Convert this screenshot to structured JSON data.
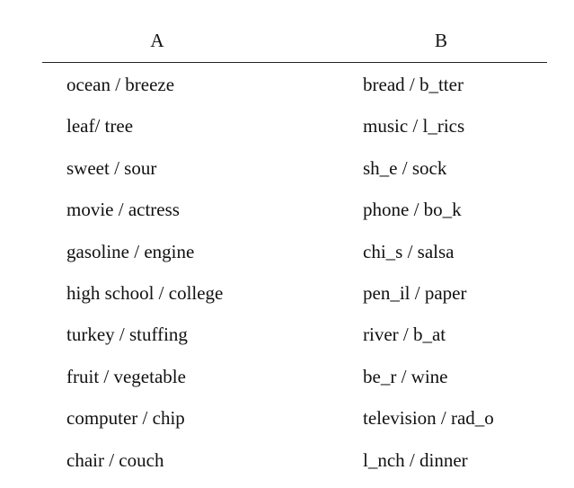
{
  "table": {
    "headers": [
      "A",
      "B"
    ],
    "rows": [
      {
        "a": "ocean / breeze",
        "b": "bread / b_tter"
      },
      {
        "a": "leaf/ tree",
        "b": "music / l_rics"
      },
      {
        "a": "sweet / sour",
        "b": "sh_e / sock"
      },
      {
        "a": "movie / actress",
        "b": "phone / bo_k"
      },
      {
        "a": "gasoline / engine",
        "b": "chi_s / salsa"
      },
      {
        "a": "high school / college",
        "b": "pen_il / paper"
      },
      {
        "a": "turkey / stuffing",
        "b": "river / b_at"
      },
      {
        "a": "fruit / vegetable",
        "b": "be_r / wine"
      },
      {
        "a": "computer / chip",
        "b": "television / rad_o"
      },
      {
        "a": "chair / couch",
        "b": "l_nch / dinner"
      }
    ]
  }
}
